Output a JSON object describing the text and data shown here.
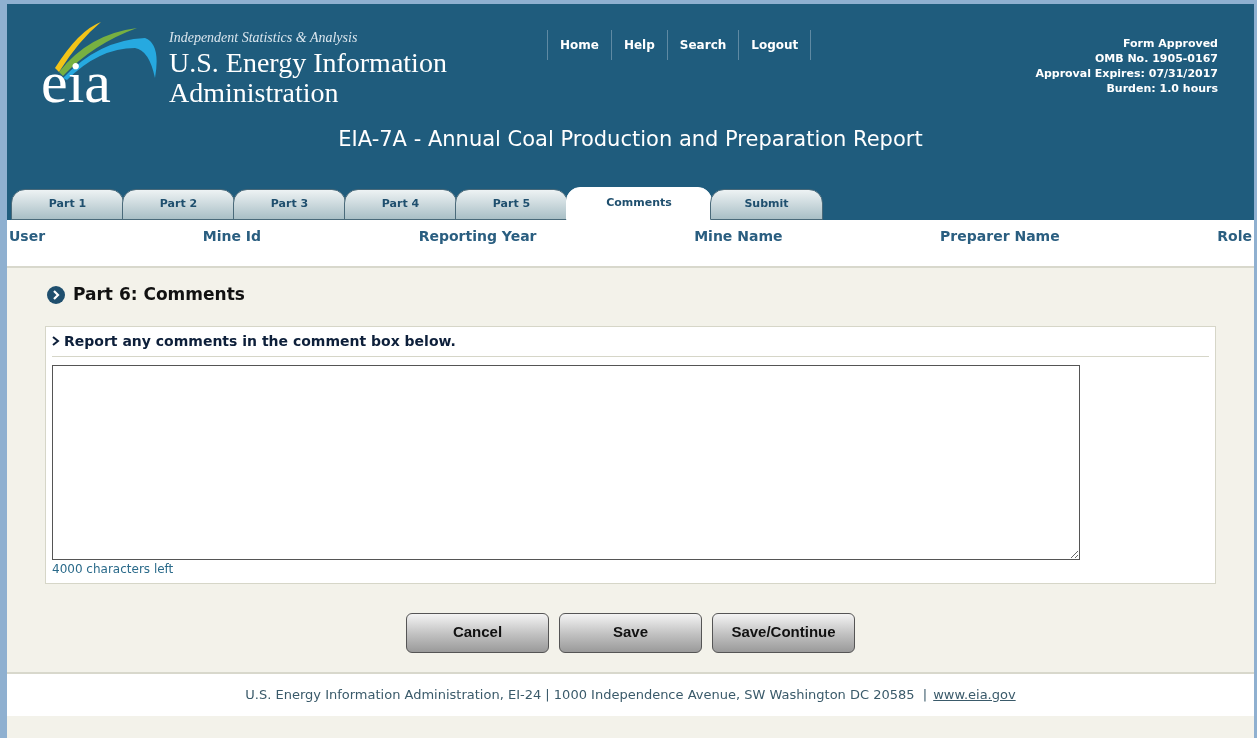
{
  "header": {
    "logo": "eia",
    "tagline": "Independent Statistics & Analysis",
    "agency_line_1": "U.S. Energy Information",
    "agency_line_2": "Administration",
    "nav": [
      "Home",
      "Help",
      "Search",
      "Logout"
    ],
    "approval": [
      "Form Approved",
      "OMB No. 1905-0167",
      "Approval Expires: 07/31/2017",
      "Burden: 1.0 hours"
    ],
    "title": "EIA-7A - Annual Coal Production and Preparation Report"
  },
  "tabs": [
    {
      "label": "Part 1",
      "selected": false
    },
    {
      "label": "Part 2",
      "selected": false
    },
    {
      "label": "Part 3",
      "selected": false
    },
    {
      "label": "Part 4",
      "selected": false
    },
    {
      "label": "Part 5",
      "selected": false
    },
    {
      "label": "Comments",
      "selected": true
    },
    {
      "label": "Submit",
      "selected": false
    }
  ],
  "info_columns": [
    "User",
    "Mine Id",
    "Reporting Year",
    "Mine Name",
    "Preparer Name",
    "Role"
  ],
  "section": {
    "title": "Part 6: Comments",
    "instruction": "Report any comments in the comment box below.",
    "counter": "4000 characters left"
  },
  "buttons": [
    "Cancel",
    "Save",
    "Save/Continue"
  ],
  "footer": {
    "text": "U.S. Energy Information Administration, EI-24 | 1000 Independence Avenue, SW Washington DC 20585  |",
    "link": "www.eia.gov"
  }
}
